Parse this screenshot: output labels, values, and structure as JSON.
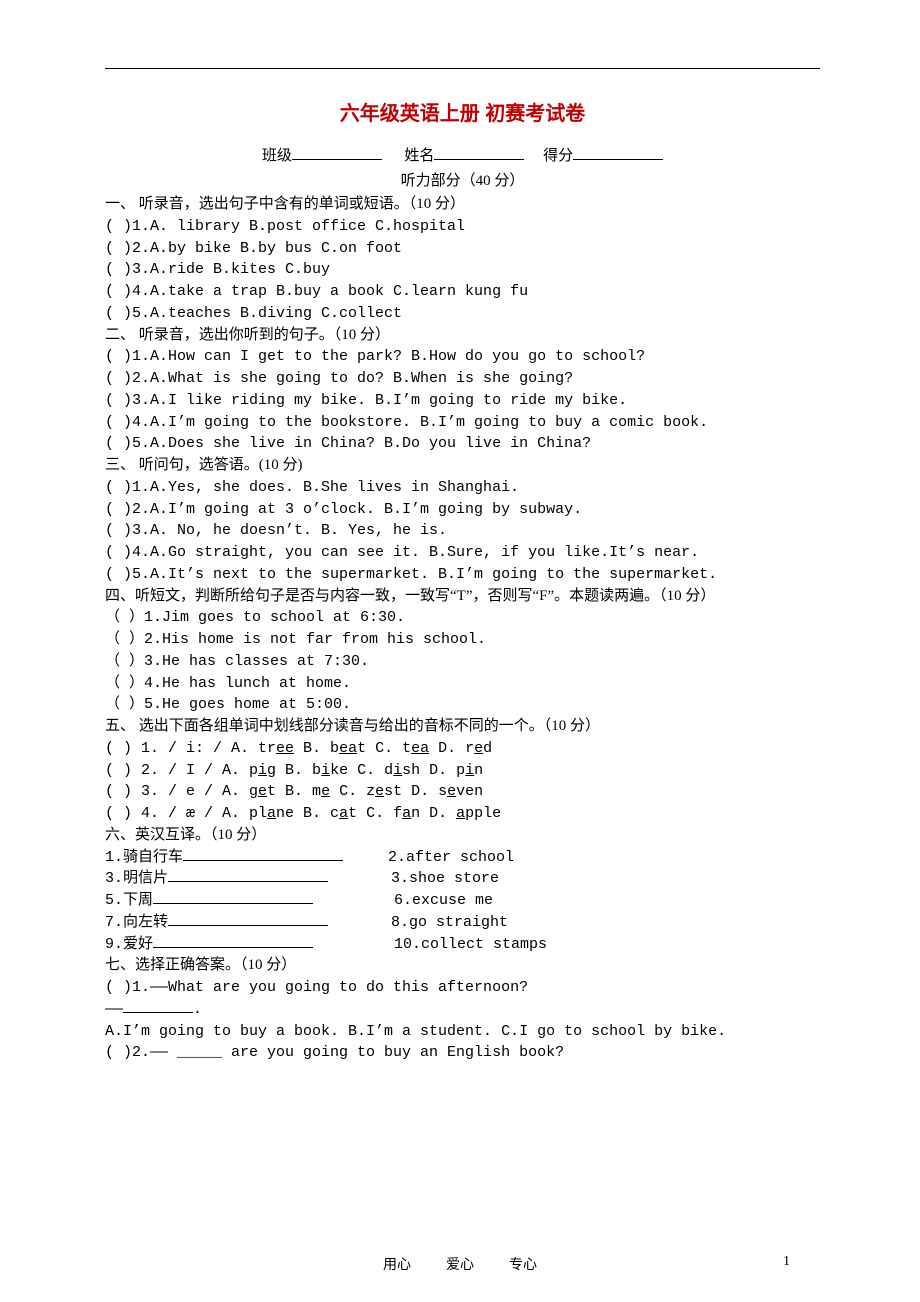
{
  "title": "六年级英语上册 初赛考试卷",
  "info": {
    "class_label": "班级",
    "name_label": "姓名",
    "score_label": "得分"
  },
  "listening_header": "听力部分（40 分）",
  "sec1": {
    "heading": "一、 听录音，选出句子中含有的单词或短语。（10 分）",
    "items": [
      {
        "text": "(      )1.A. library        B.post office       C.hospital"
      },
      {
        "text": "(      )2.A.by bike        B.by bus        C.on foot"
      },
      {
        "text": "(      )3.A.ride           B.kites         C.buy"
      },
      {
        "text": "(      )4.A.take a trap     B.buy a book     C.learn kung fu"
      },
      {
        "text": "(      )5.A.teaches        B.diving        C.collect"
      }
    ]
  },
  "sec2": {
    "heading": "二、 听录音，选出你听到的句子。（10 分）",
    "items": [
      {
        "text": "(      )1.A.How can I get to the park?     B.How do you go to school?"
      },
      {
        "text": "(      )2.A.What is she going to do?     B.When is she going?"
      },
      {
        "text": "(      )3.A.I like riding my bike.        B.I’m going to ride my bike."
      },
      {
        "text": "(      )4.A.I’m going to the bookstore.     B.I’m going to buy a comic book."
      },
      {
        "text": "(      )5.A.Does she live in China?      B.Do you live in China?"
      }
    ]
  },
  "sec3": {
    "heading": "三、 听问句，选答语。(10 分)",
    "items": [
      {
        "text": "(      )1.A.Yes, she does.             B.She lives in Shanghai."
      },
      {
        "text": "(      )2.A.I’m going at 3 o’clock.        B.I’m going by subway."
      },
      {
        "text": "(      )3.A. No, he doesn’t.          B. Yes, he is."
      },
      {
        "text": "(      )4.A.Go straight, you can see it.     B.Sure, if you like.It’s near."
      },
      {
        "text": "(      )5.A.It’s next to the supermarket.    B.I’m going to the supermarket."
      }
    ]
  },
  "sec4": {
    "heading": "四、听短文，判断所给句子是否与内容一致，一致写“T”，否则写“F”。本题读两遍。（10 分）",
    "items": [
      {
        "text": "（    ）1.Jim goes to school at 6:30."
      },
      {
        "text": "（    ）2.His home is not far from his school."
      },
      {
        "text": "（    ）3.He has classes at 7:30."
      },
      {
        "text": "（    ）4.He has lunch at home."
      },
      {
        "text": "（    ）5.He goes home at 5:00."
      }
    ]
  },
  "sec5": {
    "heading": "五、 选出下面各组单词中划线部分读音与给出的音标不同的一个。（10 分）",
    "items": [
      {
        "pre": "(   ) 1.    / i: /      A. tr",
        "u1": "ee",
        "mid1": "     B. b",
        "u2": "ea",
        "mid2": "t     C. t",
        "u3": "ea",
        "mid3": "      D. r",
        "u4": "e",
        "end": "d"
      },
      {
        "pre": "(   ) 2.    / I /       A. p",
        "u1": "i",
        "mid1": "g     B. b",
        "u2": "i",
        "mid2": "ke    C. d",
        "u3": "i",
        "mid3": "sh    D. p",
        "u4": "i",
        "end": "n"
      },
      {
        "pre": "(   ) 3.  / e /     A. g",
        "u1": "e",
        "mid1": "t     B. m",
        "u2": "e",
        "mid2": "      C. z",
        "u3": "e",
        "mid3": "st    D. s",
        "u4": "e",
        "end": "ven"
      },
      {
        "pre": "(   ) 4.  / æ /     A. pl",
        "u1": "a",
        "mid1": "ne     B. c",
        "u2": "a",
        "mid2": "t     C. f",
        "u3": "a",
        "mid3": "n     D. ",
        "u4": "a",
        "end": "pple"
      }
    ]
  },
  "sec6": {
    "heading": "六、英汉互译。（10 分）",
    "items": [
      {
        "left": "1.骑自行车",
        "right": "2.after school"
      },
      {
        "left": "3.明信片",
        "right": "3.shoe store"
      },
      {
        "left": "5.下周",
        "right": "6.excuse me"
      },
      {
        "left": "7.向左转",
        "right": "8.go straight"
      },
      {
        "left": "9.爱好",
        "right": "10.collect stamps"
      }
    ]
  },
  "sec7": {
    "heading": "七、选择正确答案。（10 分）",
    "q1_line1": "(   )1.——What are you going to do this afternoon?",
    "q1_line2": "       ——",
    "q1_answers": "A.I’m going to buy a book.  B.I’m a student. C.I go to school by bike.",
    "q2_line": "(  )2.—— _____ are you going to buy an English book?"
  },
  "footer": {
    "word1": "用心",
    "word2": "爱心",
    "word3": "专心",
    "page": "1"
  }
}
